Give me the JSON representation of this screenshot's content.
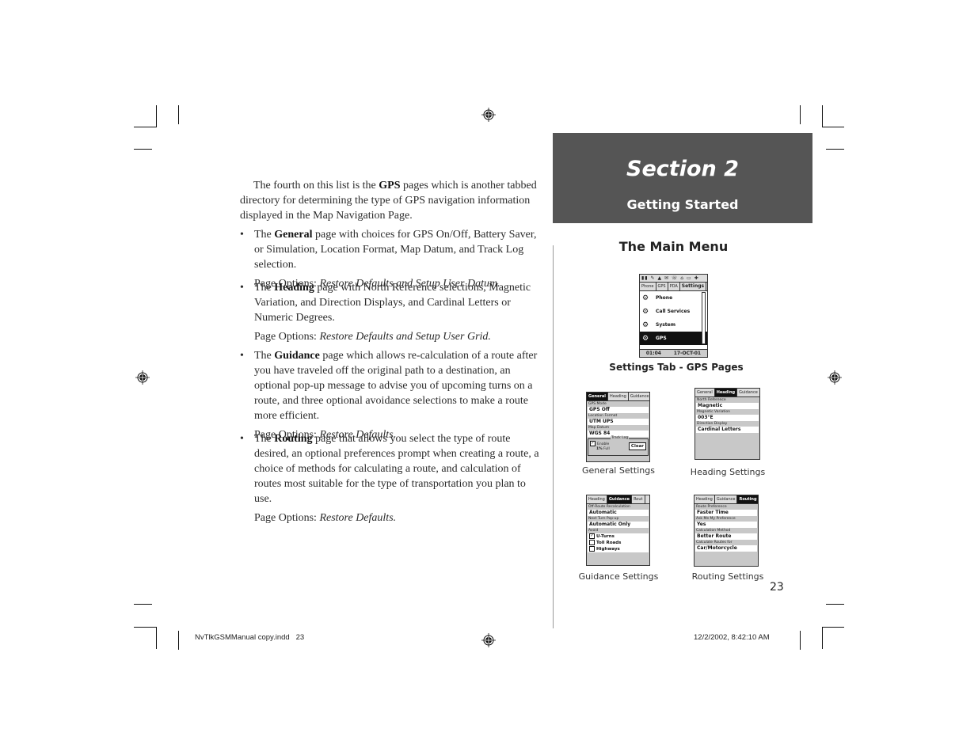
{
  "intro": {
    "before": "The fourth on this list is the ",
    "bold": "GPS",
    "after": " pages which is another tabbed directory for determining the type of GPS navigation information displayed in the Map Navigation Page."
  },
  "bullets": [
    {
      "prefix": "The ",
      "bold": "General",
      "text": " page with choices for GPS On/Off, Battery Saver, or Simulation, Location Format, Map Datum, and Track Log selection.",
      "options_label": "Page Options: ",
      "options": "Restore Defaults and Setup User Datum."
    },
    {
      "prefix": "The ",
      "bold": "Heading",
      "text": " page with North Reference selections, Magnetic Variation, and Direction Displays, and Cardinal Letters or Numeric Degrees.",
      "options_label": "Page Options: ",
      "options": "Restore Defaults and Setup User Grid."
    },
    {
      "prefix": "The ",
      "bold": "Guidance",
      "text": " page which allows re-calculation of a route after you have traveled off the original path to a destination, an optional pop-up message to advise you of upcoming turns on a route, and three optional avoidance selections to make a route more efficient.",
      "options_label": "Page Options: ",
      "options": "Restore Defaults."
    },
    {
      "prefix": "The ",
      "bold": "Routing",
      "text": " page that allows you select the type of route desired, an optional preferences prompt when creating a route, a choice of methods for calculating a route, and calculation of routes most suitable for the type of transportation you plan to use.",
      "options_label": "Page Options: ",
      "options": "Restore Defaults."
    }
  ],
  "header": {
    "section": "Section 2",
    "subtitle": "Getting Started",
    "main_menu_title": "The Main Menu"
  },
  "main_screen": {
    "status_icons": "▮▮ ✎ ▲ ✉ ☏ ⌂ ▭ ✚",
    "tabs": [
      "Phone",
      "GPS",
      "PDA",
      "Settings"
    ],
    "active_tab": "Settings",
    "items": [
      {
        "label": "Phone",
        "icon": "phone-settings-icon"
      },
      {
        "label": "Call Services",
        "icon": "call-services-icon"
      },
      {
        "label": "System",
        "icon": "system-icon"
      },
      {
        "label": "GPS",
        "icon": "gps-settings-icon",
        "selected": true
      }
    ],
    "time": "01:04",
    "date": "17-OCT-01",
    "caption": "Settings Tab - GPS Pages"
  },
  "general_screen": {
    "tabs": [
      "General",
      "Heading",
      "Guidance"
    ],
    "fields": [
      {
        "label": "GPS Mode",
        "value": "GPS Off"
      },
      {
        "label": "Location Format",
        "value": "UTM UPS"
      },
      {
        "label": "Map Datum",
        "value": "WGS 84"
      }
    ],
    "track_log_label": "Track Log",
    "enable_label": "Enable",
    "enable_checked": true,
    "percent": "1%",
    "full_label": "Full",
    "clear_label": "Clear",
    "caption": "General Settings"
  },
  "heading_screen": {
    "tabs": [
      "General",
      "Heading",
      "Guidance"
    ],
    "fields": [
      {
        "label": "North Reference",
        "value": "Magnetic"
      },
      {
        "label": "Magnetic Variation",
        "value": "003°E"
      },
      {
        "label": "Direction Display",
        "value": "Cardinal Letters"
      }
    ],
    "caption": "Heading Settings"
  },
  "guidance_screen": {
    "tabs": [
      "Heading",
      "Guidance",
      "Rout"
    ],
    "fields": [
      {
        "label": "Off-Route Recalculation",
        "value": "Automatic"
      },
      {
        "label": "Next Turn Pop-up",
        "value": "Automatic Only"
      }
    ],
    "avoid_label": "Avoid",
    "avoid": [
      {
        "label": "U-Turns",
        "checked": true
      },
      {
        "label": "Toll Roads",
        "checked": false
      },
      {
        "label": "Highways",
        "checked": false
      }
    ],
    "caption": "Guidance Settings"
  },
  "routing_screen": {
    "tabs": [
      "Heading",
      "Guidance",
      "Routing"
    ],
    "fields": [
      {
        "label": "Route Preference",
        "value": "Faster Time"
      },
      {
        "label": "Ask Me My Preference",
        "value": "Yes"
      },
      {
        "label": "Calculation Method",
        "value": "Better Route"
      },
      {
        "label": "Calculate Routes for",
        "value": "Car/Motorcycle"
      }
    ],
    "caption": "Routing Settings"
  },
  "page_number": "23",
  "slug": {
    "file": "NvTlkGSMManual copy.indd   23",
    "timestamp": "12/2/2002, 8:42:10 AM"
  }
}
